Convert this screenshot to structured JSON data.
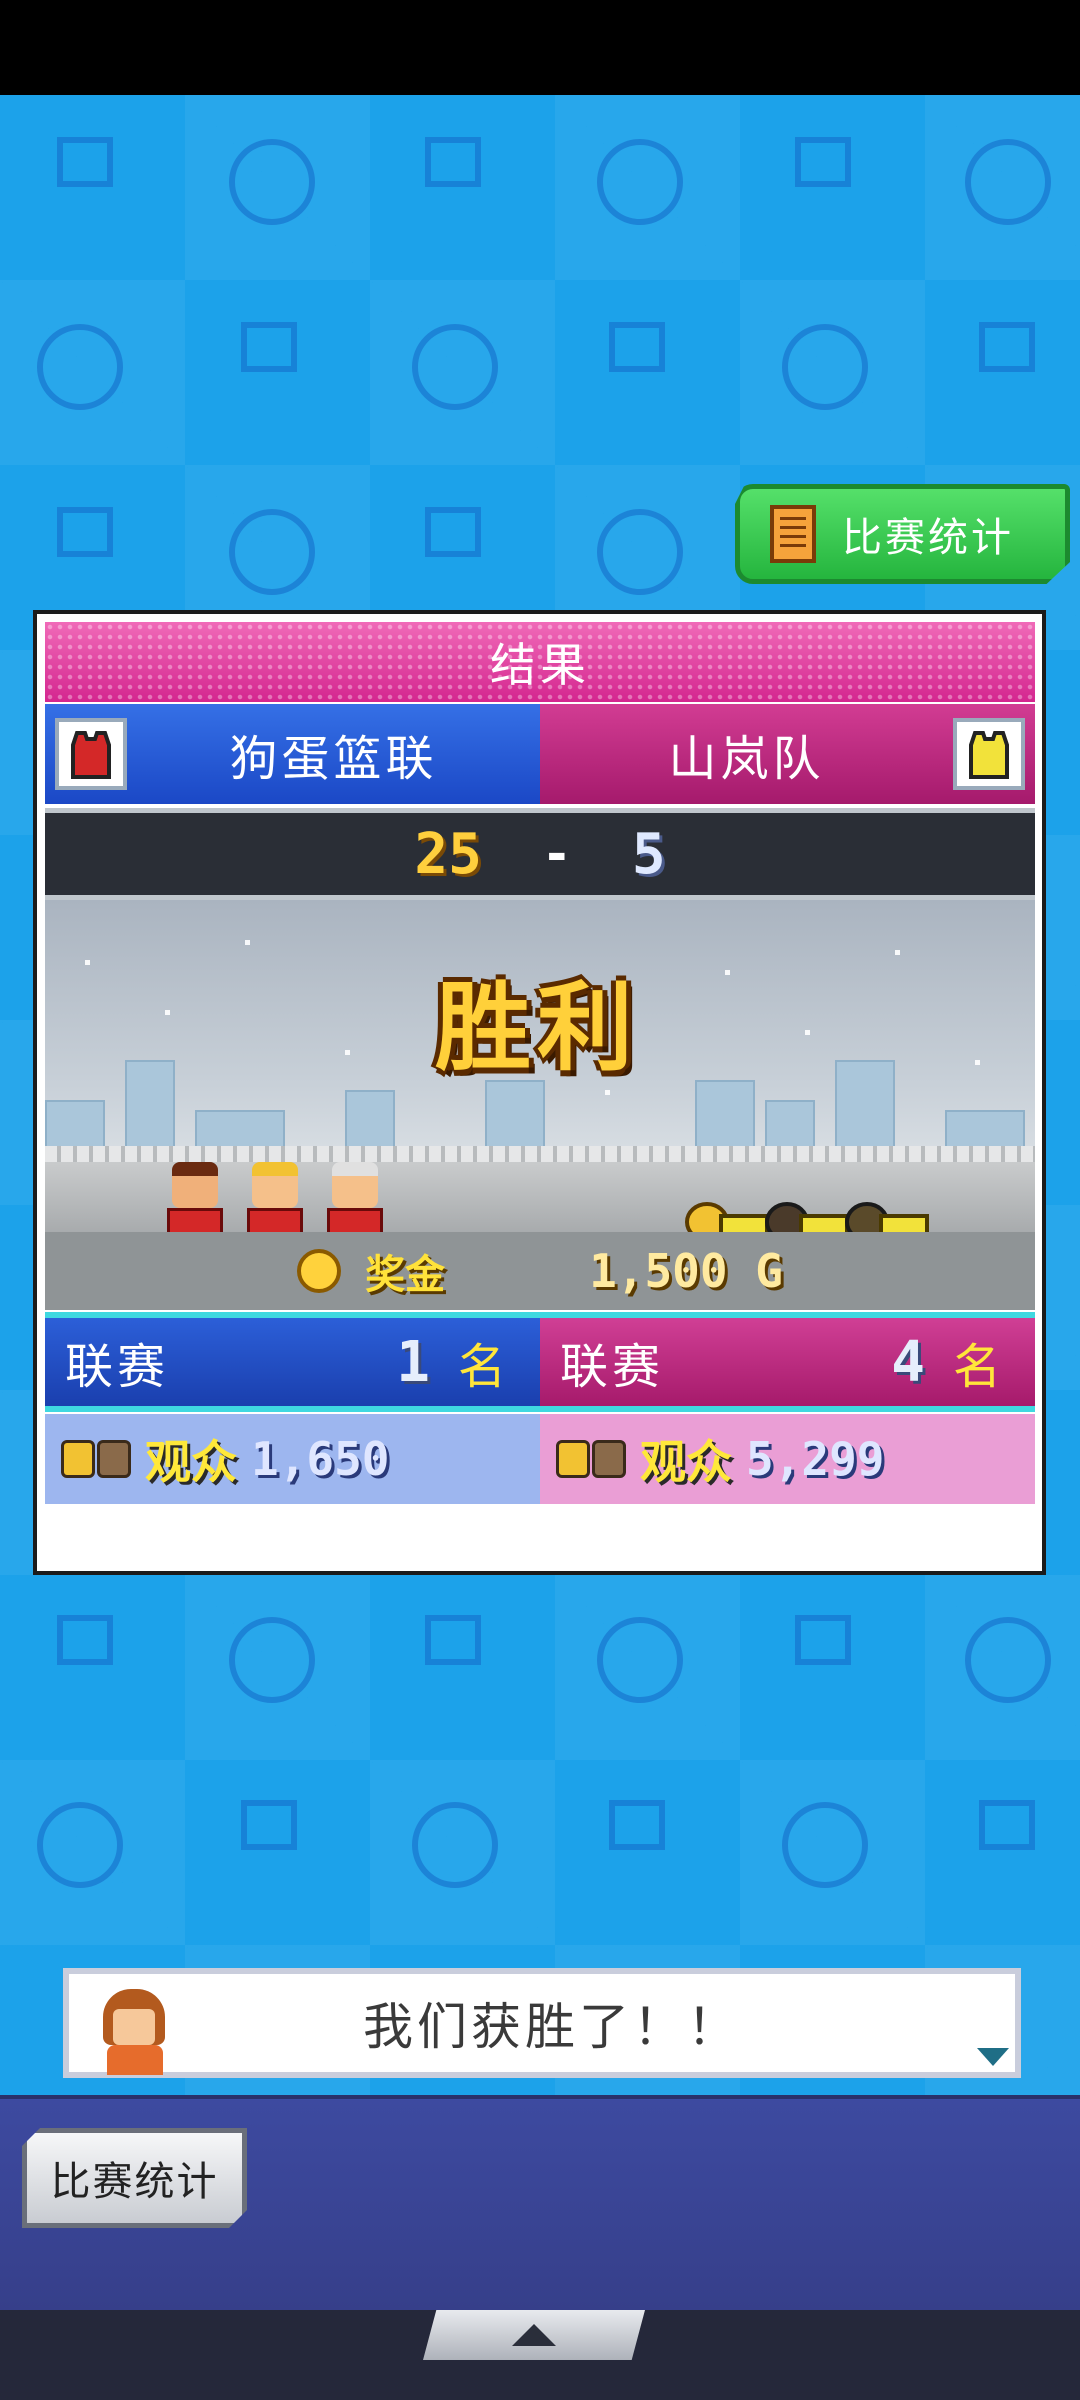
{
  "top_button": {
    "label": "比赛统计"
  },
  "result": {
    "title": "结果",
    "home_team": {
      "name": "狗蛋篮联",
      "jersey_color": "#d42828"
    },
    "away_team": {
      "name": "山岚队",
      "jersey_color": "#f2e23a"
    },
    "score": {
      "home": "25",
      "dash": "-",
      "away": "5"
    },
    "outcome": "胜利",
    "prize": {
      "label": "奖金",
      "value": "1,500 G"
    },
    "league": {
      "home": {
        "label": "联赛",
        "rank": "1",
        "unit": "名"
      },
      "away": {
        "label": "联赛",
        "rank": "4",
        "unit": "名"
      }
    },
    "audience": {
      "home": {
        "label": "观众",
        "value": "1,650"
      },
      "away": {
        "label": "观众",
        "value": "5,299"
      }
    }
  },
  "dialog": {
    "text": "我们获胜了！！"
  },
  "bottom_button": {
    "label": "比赛统计"
  },
  "colors": {
    "background": "#1ca2ea",
    "home_accent": "#1b48c6",
    "away_accent": "#a51a6c",
    "gold": "#ffd03a"
  }
}
